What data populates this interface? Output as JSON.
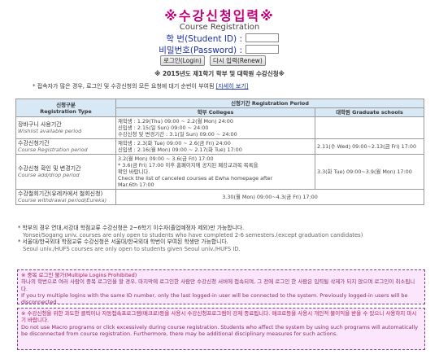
{
  "header": {
    "title": "※수강신청입력※",
    "subtitle": "Course Registration"
  },
  "login": {
    "id_label": "학 번(Student ID) :",
    "pw_label": "비밀번호(Password) :",
    "login_button": "로그인(Login)",
    "renew_button": "다시 입력(Renew)"
  },
  "year_notice": "※ 2015년도 제1학기 학부 및 대학원 수강신청※",
  "notice": {
    "text": "* 접속자가 많은 경우, 로그인 및 수강신청의 모든 요청에 대기 순번이 부여됨",
    "link": "[자세히 보기]"
  },
  "table": {
    "head_type_ko": "신청구분",
    "head_type_en": "Registration Type",
    "head_period": "신청기간 Registration Period",
    "head_college": "학부 Colleges",
    "head_grad": "대학원 Graduate schools",
    "rows": [
      {
        "type_ko": "장바구니 사용기간",
        "type_en": "Wishlist available period",
        "college": [
          "재학생 : 1.29(Thu) 09:00 ~ 2.2(월 Mon) 24:00",
          "신입생 : 2.15(일 Sun) 09:00 ~ 24:00",
          "수강신청 및 변경기간 : 3.1(일 Sun) 09:00 ~ 24:00"
        ],
        "grad": ""
      },
      {
        "type_ko": "수강신청기간",
        "type_en": "Course Registration period",
        "college": [
          "재학생 : 2.3(화 Tue) 09:00 ~ 2.6(금 Fri) 24:00",
          "신입생 : 2.16(월 Mon) 09:00 ~ 2.17(화 Tue) 17:00"
        ],
        "grad": "2.11(수 Wed) 09:00~2.13(금 Fri) 17:00"
      },
      {
        "type_ko": "수강신청 확인 및 변경기간",
        "type_en": "Course add/drop period",
        "college": [
          "3.2(월 Mon) 09:00 ~ 3.6(금 Fri) 17:00",
          "* 3.6(금 Fri) 17:00 이후 홈페이지에 공지된 폐강교과목 목록을",
          "확인 바랍니다.",
          "Check the list of canceled courses at Ewha homepage after",
          "Mar.6th 17:00"
        ],
        "grad": "3.3(화 Tue) 09:00~3.9(월 Mon) 17:00"
      },
      {
        "type_ko": "수강철회기간(유레카에서 철회신청)",
        "type_en": "Course withdrawal period(Eureka)",
        "span": "3.30(월 Mon) 09:00~4.3(금 Fri) 17:00"
      }
    ]
  },
  "notes": [
    {
      "ko": "* 학부의 경우 연대,서강대 학점교류 수강신청은 2~6학기 이수자(졸업예정자 제외)만 가능합니다.",
      "en": "Yonsei/Sogang univ. courses are only open to students who have completed 2-6 semesters.(except graduation candidates)"
    },
    {
      "ko": "* 서울대/한국외대 학점교류 수강신청은 서울대/한국외대 학번이 부여된 학생만 가능합니다.",
      "en": "Seoul univ./HUFS courses are only open to students given Seoul univ./HUFS ID."
    }
  ],
  "box1": {
    "title": "※ 중복 로그인 불가(Multiple Logins Prohibited)",
    "ko": "하나의 학번으로 여러 사람이 중복 로그인을 할 경우, 마지막에 로그인한 사람만 수강신청 서버에 접속되며, 그 전에 로그인 한 사람은 입력될 삭제가 되지 않으며 로그인이 취소됩니다.",
    "en": "If you try multiple logins with the same ID number, only the last logged-in user will be connected to the system. Previously logged-in users will be disconnected."
  },
  "box2": {
    "ko": "※ 수강신청을 위한 과도한 클릭이나 자동접속프로그램(매크로)등을 사용시 수강신청프로그램이 강제 종료됩니다. 매크로등을 사용시 개인적 불이익을 받을 수 있으니 사용하지 마시기 바랍니다.",
    "en": "Do not use Macro programs or click excessively during course registration. Students who affect the system by using such programs will automatically be disconnected from course registration. Furthermore, there may be additional disciplinary measures for such actions."
  }
}
